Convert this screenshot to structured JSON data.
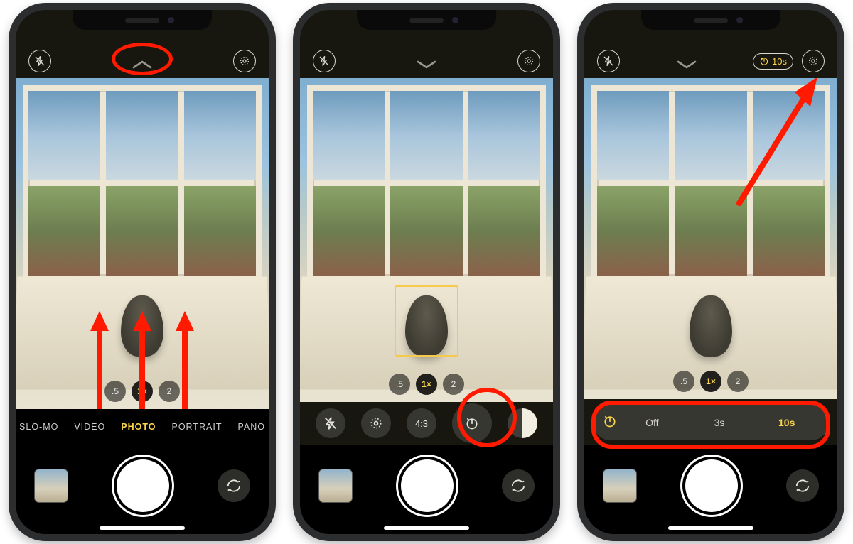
{
  "modes": {
    "slomo": "SLO-MO",
    "video": "VIDEO",
    "photo": "PHOTO",
    "portrait": "PORTRAIT",
    "pano": "PANO"
  },
  "zoom": {
    "wide": ".5",
    "one": "1×",
    "two": "2"
  },
  "optionbar": {
    "aspect": "4:3"
  },
  "timer_row": {
    "off": "Off",
    "three": "3s",
    "ten": "10s"
  },
  "timer_pill": {
    "value": "10s"
  }
}
